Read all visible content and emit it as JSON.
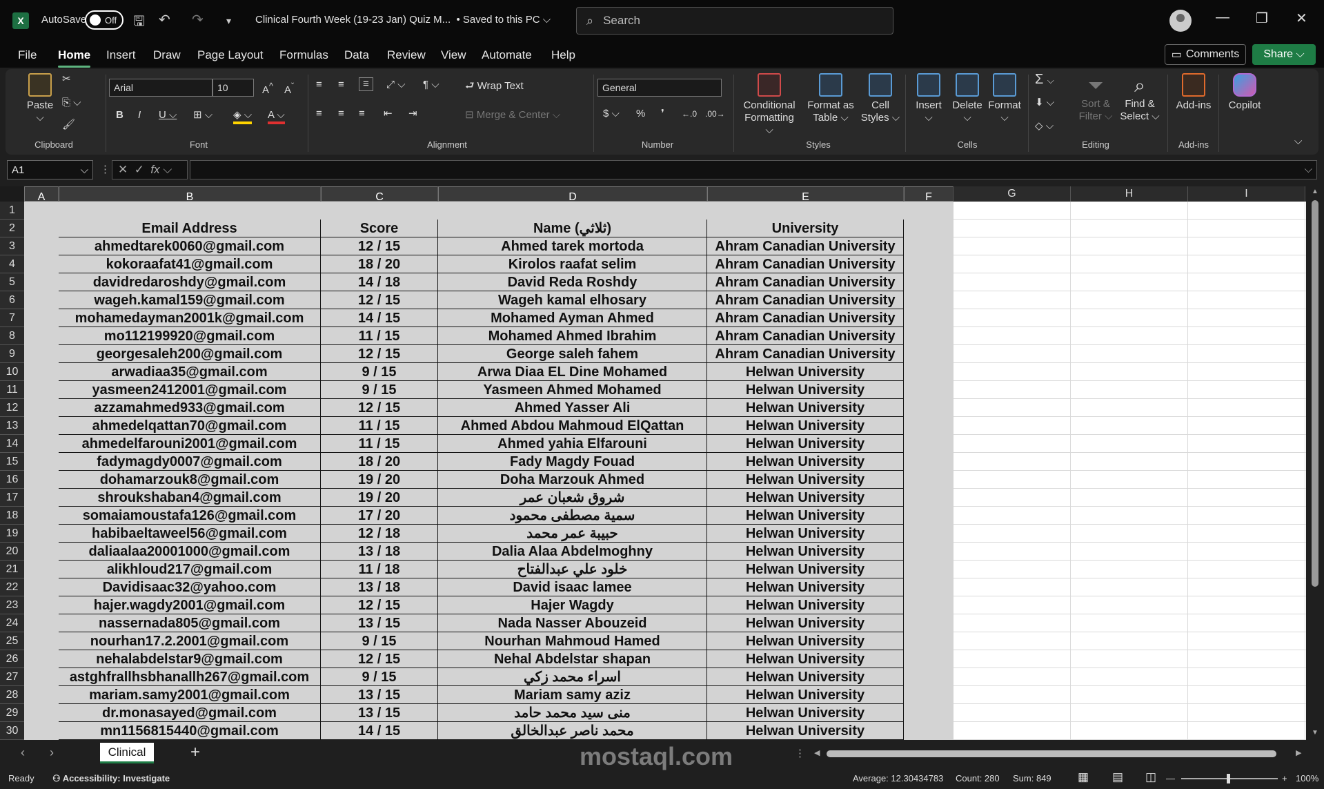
{
  "titlebar": {
    "autosave_label": "AutoSave",
    "autosave_state": "Off",
    "doc_title": "Clinical Fourth Week (19-23 Jan) Quiz M...",
    "saved_status": "•  Saved to this PC ⌵",
    "search_placeholder": "Search"
  },
  "menu": [
    "File",
    "Home",
    "Insert",
    "Draw",
    "Page Layout",
    "Formulas",
    "Data",
    "Review",
    "View",
    "Automate",
    "Help"
  ],
  "active_menu": "Home",
  "top_buttons": {
    "comments": "Comments",
    "share": "Share"
  },
  "ribbon": {
    "clipboard": {
      "paste": "Paste",
      "label": "Clipboard"
    },
    "font": {
      "family": "Arial",
      "size": "10",
      "label": "Font"
    },
    "alignment": {
      "wrap": "Wrap Text",
      "merge": "Merge & Center",
      "label": "Alignment"
    },
    "number": {
      "format": "General",
      "label": "Number"
    },
    "styles": {
      "conditional": "Conditional",
      "conditional2": "Formatting ⌵",
      "format_table": "Format as",
      "format_table2": "Table ⌵",
      "cell_styles": "Cell",
      "cell_styles2": "Styles ⌵",
      "label": "Styles"
    },
    "cells": {
      "insert": "Insert",
      "delete": "Delete",
      "format": "Format",
      "label": "Cells"
    },
    "editing": {
      "sort": "Sort &",
      "sort2": "Filter ⌵",
      "find": "Find &",
      "find2": "Select ⌵",
      "label": "Editing"
    },
    "addins": {
      "addins": "Add-ins",
      "label": "Add-ins"
    },
    "copilot": {
      "label": "Copilot"
    }
  },
  "formula": {
    "namebox": "A1"
  },
  "columns": [
    "A",
    "B",
    "C",
    "D",
    "E",
    "F",
    "G",
    "H",
    "I"
  ],
  "table": {
    "headers": [
      "Email Address",
      "Score",
      "Name (ثلاثي)",
      "University"
    ],
    "rows": [
      [
        "ahmedtarek0060@gmail.com",
        "12 / 15",
        "Ahmed tarek mortoda",
        "Ahram Canadian University"
      ],
      [
        "kokoraafat41@gmail.com",
        "18 / 20",
        "Kirolos raafat selim",
        "Ahram Canadian University"
      ],
      [
        "davidredaroshdy@gmail.com",
        "14 / 18",
        "David Reda Roshdy",
        "Ahram Canadian University"
      ],
      [
        "wageh.kamal159@gmail.com",
        "12 / 15",
        "Wageh kamal elhosary",
        "Ahram Canadian University"
      ],
      [
        "mohamedayman2001k@gmail.com",
        "14 / 15",
        "Mohamed Ayman Ahmed",
        "Ahram Canadian University"
      ],
      [
        "mo112199920@gmail.com",
        "11 / 15",
        "Mohamed Ahmed Ibrahim",
        "Ahram Canadian University"
      ],
      [
        "georgesaleh200@gmail.com",
        "12 / 15",
        "George saleh fahem",
        "Ahram Canadian University"
      ],
      [
        "arwadiaa35@gmail.com",
        "9 / 15",
        "Arwa Diaa EL Dine Mohamed",
        "Helwan University"
      ],
      [
        "yasmeen2412001@gmail.com",
        "9 / 15",
        "Yasmeen Ahmed Mohamed",
        "Helwan University"
      ],
      [
        "azzamahmed933@gmail.com",
        "12 / 15",
        "Ahmed Yasser Ali",
        "Helwan University"
      ],
      [
        "ahmedelqattan70@gmail.com",
        "11 / 15",
        "Ahmed Abdou Mahmoud ElQattan",
        "Helwan University"
      ],
      [
        "ahmedelfarouni2001@gmail.com",
        "11 / 15",
        "Ahmed yahia Elfarouni",
        "Helwan University"
      ],
      [
        "fadymagdy0007@gmail.com",
        "18 / 20",
        "Fady Magdy Fouad",
        "Helwan University"
      ],
      [
        "dohamarzouk8@gmail.com",
        "19 / 20",
        "Doha Marzouk Ahmed",
        "Helwan University"
      ],
      [
        "shroukshaban4@gmail.com",
        "19 / 20",
        "شروق شعبان عمر",
        "Helwan University"
      ],
      [
        "somaiamoustafa126@gmail.com",
        "17 / 20",
        "سمية مصطفى محمود",
        "Helwan University"
      ],
      [
        "habibaeltaweel56@gmail.com",
        "12 / 18",
        "حبيبة عمر محمد",
        "Helwan University"
      ],
      [
        "daliaalaa20001000@gmail.com",
        "13 / 18",
        "Dalia Alaa Abdelmoghny",
        "Helwan University"
      ],
      [
        "alikhloud217@gmail.com",
        "11 / 18",
        "خلود علي عبدالفتاح",
        "Helwan University"
      ],
      [
        "Davidisaac32@yahoo.com",
        "13 / 18",
        "David isaac lamee",
        "Helwan University"
      ],
      [
        "hajer.wagdy2001@gmail.com",
        "12 / 15",
        "Hajer Wagdy",
        "Helwan University"
      ],
      [
        "nassernada805@gmail.com",
        "13 / 15",
        "Nada Nasser Abouzeid",
        "Helwan University"
      ],
      [
        "nourhan17.2.2001@gmail.com",
        "9 / 15",
        "Nourhan Mahmoud Hamed",
        "Helwan University"
      ],
      [
        "nehalabdelstar9@gmail.com",
        "12 / 15",
        "Nehal Abdelstar shapan",
        "Helwan University"
      ],
      [
        "astghfrallhsbhanallh267@gmail.com",
        "9 / 15",
        "اسراء محمد زكي",
        "Helwan University"
      ],
      [
        "mariam.samy2001@gmail.com",
        "13 / 15",
        "Mariam samy aziz",
        "Helwan University"
      ],
      [
        "dr.monasayed@gmail.com",
        "13 / 15",
        "منى سيد محمد حامد",
        "Helwan University"
      ],
      [
        "mn1156815440@gmail.com",
        "14 / 15",
        "محمد ناصر عبدالخالق",
        "Helwan University"
      ]
    ]
  },
  "sheet_tab": "Clinical",
  "status": {
    "ready": "Ready",
    "accessibility": "Accessibility: Investigate",
    "average": "Average: 12.30434783",
    "count": "Count: 280",
    "sum": "Sum: 849",
    "zoom": "100%"
  },
  "watermark": "mostaql.com"
}
